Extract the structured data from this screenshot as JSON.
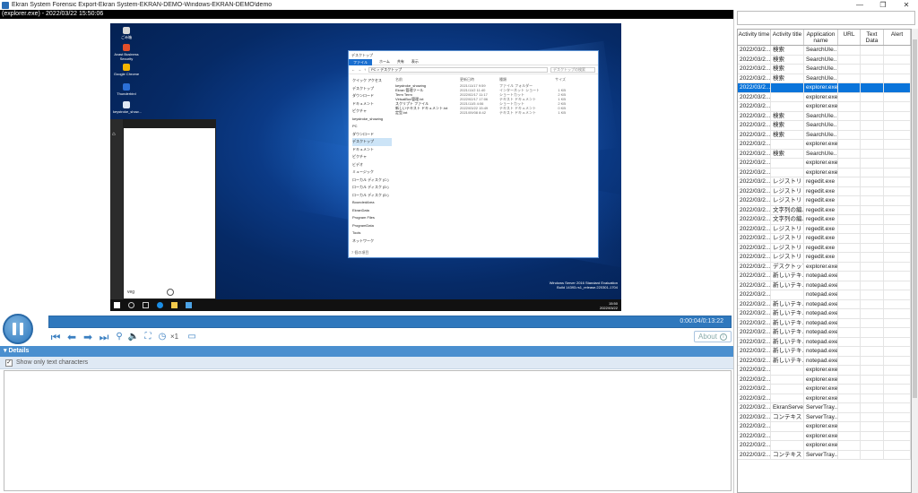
{
  "window": {
    "title": "Ekran System Forensic Export-Ekran System-EKRAN-DEMO-Windows-EKRAN-DEMO\\demo",
    "minimize": "—",
    "maximize": "❐",
    "close": "✕"
  },
  "header": {
    "label": "(explorer.exe) - 2022/03/22 15:50:06"
  },
  "desktop": {
    "icons": [
      "ごみ箱",
      "Avast Business Security",
      "Google Chrome",
      "Thunderbird",
      "keystroke_show..."
    ],
    "system_info": [
      "Windows Server 2016 Standard Evaluation",
      "Build 14393.rs1_release.220301-1704"
    ],
    "clock": [
      "15:50",
      "2022/03/22"
    ],
    "start_user": "veg"
  },
  "explorer": {
    "title": "デスクトップ",
    "ribbon": [
      "ファイル",
      "ホーム",
      "共有",
      "表示"
    ],
    "address": "PC > デスクトップ",
    "search_placeholder": "デスクトップの検索",
    "nav": [
      "クイック アクセス",
      "デスクトップ",
      "ダウンロード",
      "ドキュメント",
      "ピクチャ",
      "keystroke_showing",
      "PC",
      "ダウンロード",
      "デスクトップ",
      "ドキュメント",
      "ピクチャ",
      "ビデオ",
      "ミュージック",
      "ローカル ディスク (C:)",
      "ローカル ディスク (D:)",
      "ローカル ディスク (D:)",
      "BoundedArea",
      "EkranData",
      "Program Files",
      "ProgramData",
      "Tools",
      "ネットワーク"
    ],
    "nav_selected_index": 8,
    "columns": [
      "名前",
      "更新日時",
      "種類",
      "サイズ"
    ],
    "files": [
      [
        "keystroke_showing",
        "2021/11/17 9:59",
        "ファイル フォルダー",
        ""
      ],
      [
        "Ekran 管理ツール",
        "2021/11/2 11:40",
        "インターネット ショートカット",
        "1 KB"
      ],
      [
        "Term Term",
        "2022/02/17 11:17",
        "ショートカット",
        "2 KB"
      ],
      [
        "VirtualBox管理.txt",
        "2022/02/17 17:06",
        "テキスト ドキュメント",
        "1 KB"
      ],
      [
        "スクリプト ファイル",
        "2021/11/5 4:06",
        "ショートカット",
        "2 KB"
      ],
      [
        "新しいテキスト ドキュメント.txt",
        "2022/03/22 15:49",
        "テキスト ドキュメント",
        "0 KB"
      ],
      [
        "定型.txt",
        "2021/09/08 8:42",
        "テキスト ドキュメント",
        "1 KB"
      ]
    ],
    "status": "7 個の項目"
  },
  "player": {
    "progress": 0.36,
    "time": "0:00:04/0:13:22",
    "speed": "×1",
    "about": "About",
    "controls": [
      "first-icon",
      "prev-icon",
      "next-icon",
      "last-icon",
      "zoom-icon",
      "volume-icon",
      "fit-icon",
      "speed-icon",
      "text-icon"
    ]
  },
  "details": {
    "header": "Details",
    "show_only_text": "Show only text characters"
  },
  "activity": {
    "columns": [
      "Activity time",
      "Activity title",
      "Application name",
      "URL",
      "Text Data",
      "Alert"
    ],
    "selected_index": 4,
    "rows": [
      [
        "2022/03/2...",
        "検索",
        "SearchUIe...",
        "",
        "",
        ""
      ],
      [
        "2022/03/2...",
        "検索",
        "SearchUIe...",
        "",
        "",
        ""
      ],
      [
        "2022/03/2...",
        "検索",
        "SearchUIe...",
        "",
        "",
        ""
      ],
      [
        "2022/03/2...",
        "検索",
        "SearchUIe...",
        "",
        "",
        ""
      ],
      [
        "2022/03/2...",
        "",
        "explorer.exe",
        "",
        "",
        ""
      ],
      [
        "2022/03/2...",
        "",
        "explorer.exe",
        "",
        "",
        ""
      ],
      [
        "2022/03/2...",
        "",
        "explorer.exe",
        "",
        "",
        ""
      ],
      [
        "2022/03/2...",
        "検索",
        "SearchUIe...",
        "",
        "",
        ""
      ],
      [
        "2022/03/2...",
        "検索",
        "SearchUIe...",
        "",
        "",
        ""
      ],
      [
        "2022/03/2...",
        "検索",
        "SearchUIe...",
        "",
        "",
        ""
      ],
      [
        "2022/03/2...",
        "",
        "explorer.exe",
        "",
        "",
        ""
      ],
      [
        "2022/03/2...",
        "検索",
        "SearchUIe...",
        "",
        "",
        ""
      ],
      [
        "2022/03/2...",
        "",
        "explorer.exe",
        "",
        "",
        ""
      ],
      [
        "2022/03/2...",
        "",
        "explorer.exe",
        "",
        "",
        ""
      ],
      [
        "2022/03/2...",
        "レジストリ エ...",
        "regedit.exe",
        "",
        "",
        ""
      ],
      [
        "2022/03/2...",
        "レジストリ エ...",
        "regedit.exe",
        "",
        "",
        ""
      ],
      [
        "2022/03/2...",
        "レジストリ エ...",
        "regedit.exe",
        "",
        "",
        ""
      ],
      [
        "2022/03/2...",
        "文字列の編...",
        "regedit.exe",
        "",
        "",
        ""
      ],
      [
        "2022/03/2...",
        "文字列の編...",
        "regedit.exe",
        "",
        "",
        ""
      ],
      [
        "2022/03/2...",
        "レジストリ エ...",
        "regedit.exe",
        "",
        "",
        ""
      ],
      [
        "2022/03/2...",
        "レジストリ エ...",
        "regedit.exe",
        "",
        "",
        ""
      ],
      [
        "2022/03/2...",
        "レジストリ エ...",
        "regedit.exe",
        "",
        "",
        ""
      ],
      [
        "2022/03/2...",
        "レジストリ エ...",
        "regedit.exe",
        "",
        "",
        ""
      ],
      [
        "2022/03/2...",
        "デスクトップ",
        "explorer.exe",
        "",
        "",
        ""
      ],
      [
        "2022/03/2...",
        "新しいテキ...",
        "notepad.exe",
        "",
        "",
        ""
      ],
      [
        "2022/03/2...",
        "新しいテキ...",
        "notepad.exe",
        "",
        "",
        ""
      ],
      [
        "2022/03/2...",
        "",
        "notepad.exe",
        "",
        "",
        ""
      ],
      [
        "2022/03/2...",
        "新しいテキ...",
        "notepad.exe",
        "",
        "",
        ""
      ],
      [
        "2022/03/2...",
        "新しいテキ...",
        "notepad.exe",
        "",
        "",
        ""
      ],
      [
        "2022/03/2...",
        "新しいテキ...",
        "notepad.exe",
        "",
        "",
        ""
      ],
      [
        "2022/03/2...",
        "新しいテキ...",
        "notepad.exe",
        "",
        "",
        ""
      ],
      [
        "2022/03/2...",
        "新しいテキ...",
        "notepad.exe",
        "",
        "",
        ""
      ],
      [
        "2022/03/2...",
        "新しいテキ...",
        "notepad.exe",
        "",
        "",
        ""
      ],
      [
        "2022/03/2...",
        "新しいテキ...",
        "notepad.exe",
        "",
        "",
        ""
      ],
      [
        "2022/03/2...",
        "",
        "explorer.exe",
        "",
        "",
        ""
      ],
      [
        "2022/03/2...",
        "",
        "explorer.exe",
        "",
        "",
        ""
      ],
      [
        "2022/03/2...",
        "",
        "explorer.exe",
        "",
        "",
        ""
      ],
      [
        "2022/03/2...",
        "",
        "explorer.exe",
        "",
        "",
        ""
      ],
      [
        "2022/03/2...",
        "EkranServe...",
        "ServerTray...",
        "",
        "",
        ""
      ],
      [
        "2022/03/2...",
        "コンテキスト",
        "ServerTray...",
        "",
        "",
        ""
      ],
      [
        "2022/03/2...",
        "",
        "explorer.exe",
        "",
        "",
        ""
      ],
      [
        "2022/03/2...",
        "",
        "explorer.exe",
        "",
        "",
        ""
      ],
      [
        "2022/03/2...",
        "",
        "explorer.exe",
        "",
        "",
        ""
      ],
      [
        "2022/03/2...",
        "コンテキスト",
        "ServerTray...",
        "",
        "",
        ""
      ]
    ]
  }
}
